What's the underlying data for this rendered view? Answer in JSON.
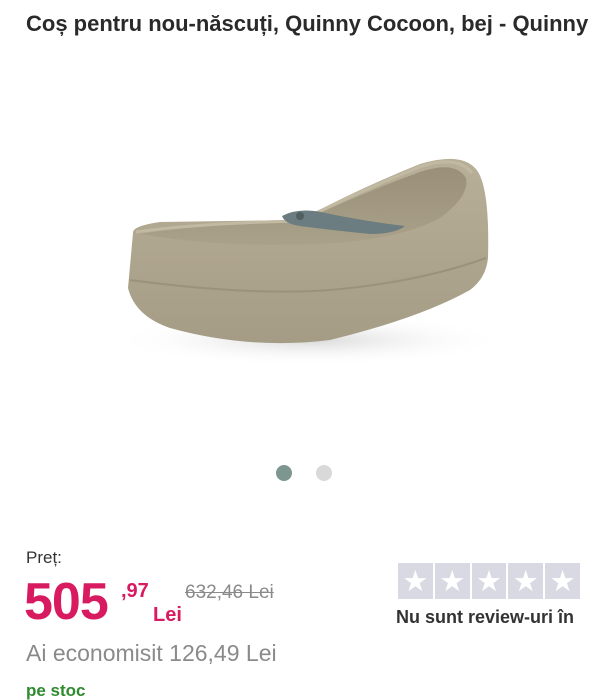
{
  "product": {
    "title": "Coș pentru nou-născuți, Quinny Cocoon, bej - Quinny",
    "image_alt": "product-image-cocoon"
  },
  "gallery": {
    "dots": [
      {
        "name": "gallery-dot-1",
        "active": true
      },
      {
        "name": "gallery-dot-2",
        "active": false
      }
    ]
  },
  "price": {
    "label": "Preț:",
    "integer": "505",
    "cents": ",97",
    "currency": "Lei",
    "old_price": "632,46 Lei",
    "savings": "Ai economisit 126,49 Lei"
  },
  "stock": {
    "status": "pe stoc"
  },
  "reviews": {
    "stars": [
      "star-icon",
      "star-icon",
      "star-icon",
      "star-icon",
      "star-icon"
    ],
    "rating_filled": 0,
    "text": "Nu sunt review-uri în"
  },
  "colors": {
    "title": "#2a2a2a",
    "price": "#d81b60",
    "stock": "#2e8b2e",
    "dot_active": "#7e9690",
    "dot_inactive": "#d9d9d9",
    "star_bg": "#d9d9e3",
    "product_beige": "#b3aa93",
    "product_strap": "#6b7d80"
  }
}
